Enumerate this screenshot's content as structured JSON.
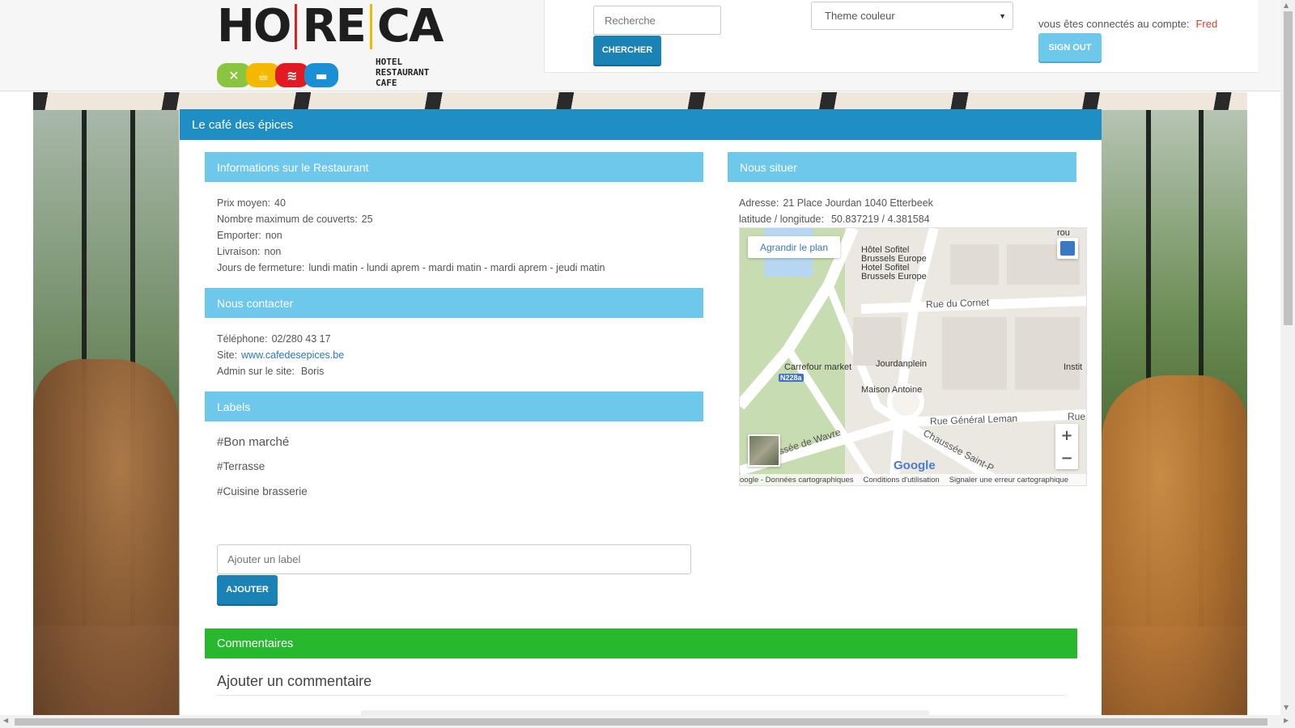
{
  "logo": {
    "text_ho": "HO",
    "text_re": "RE",
    "text_ca": "CA",
    "tagline": [
      "HOTEL",
      "RESTAURANT",
      "CAFE"
    ]
  },
  "header": {
    "search_placeholder": "Recherche",
    "search_button": "CHERCHER",
    "theme_select": "Theme couleur",
    "account_label": "vous êtes connectés au compte:",
    "account_user": "Fred",
    "signout_button": "SIGN OUT"
  },
  "restaurant": {
    "title": "Le café des épices",
    "info_header": "Informations sur le Restaurant",
    "info": [
      {
        "label": "Prix moyen:",
        "value": "40"
      },
      {
        "label": "Nombre maximum de couverts:",
        "value": "25"
      },
      {
        "label": "Emporter:",
        "value": "non"
      },
      {
        "label": "Livraison:",
        "value": "non"
      },
      {
        "label": "Jours de fermeture:",
        "value": "lundi matin - lundi aprem - mardi matin - mardi aprem - jeudi matin"
      }
    ],
    "contact_header": "Nous contacter",
    "contact": {
      "phone_label": "Téléphone:",
      "phone": "02/280 43 17",
      "site_label": "Site:",
      "site": "www.cafedesepices.be",
      "admin_label": "Admin sur le site:",
      "admin": "Boris"
    },
    "labels_header": "Labels",
    "labels": [
      "#Bon marché",
      "#Terrasse",
      "#Cuisine brasserie"
    ],
    "label_placeholder": "Ajouter un label",
    "add_button": "AJOUTER",
    "location_header": "Nous situer",
    "address_label": "Adresse:",
    "address": "21 Place Jourdan 1040 Etterbeek",
    "latlng_label": "latitude / longitude:",
    "latlng": "50.837219 / 4.381584",
    "comments_header": "Commentaires",
    "add_comment_title": "Ajouter un commentaire"
  },
  "map": {
    "enlarge": "Agrandir le plan",
    "hotel": [
      "Hôtel Sofitel",
      "Brussels Europe",
      "Hotel Sofitel",
      "Brussels Europe"
    ],
    "streets": {
      "cornet": "Rue du Cornet",
      "leman": "Rue Général Leman",
      "wavre": "ussée de Wavre",
      "saint": "Chaussée Saint-P",
      "rue": "Rue",
      "instit": "Instit",
      "top": "rou"
    },
    "places": {
      "carrefour": "Carrefour market",
      "jourdan": "Jourdanplein",
      "antoine": "Maison Antoine"
    },
    "route": "N228a",
    "google": "Google",
    "footer": [
      "oogle - Données cartographiques",
      "Conditions d'utilisation",
      "Signaler une erreur cartographique"
    ],
    "icons": {
      "zoom_in": "+",
      "zoom_out": "−"
    }
  }
}
